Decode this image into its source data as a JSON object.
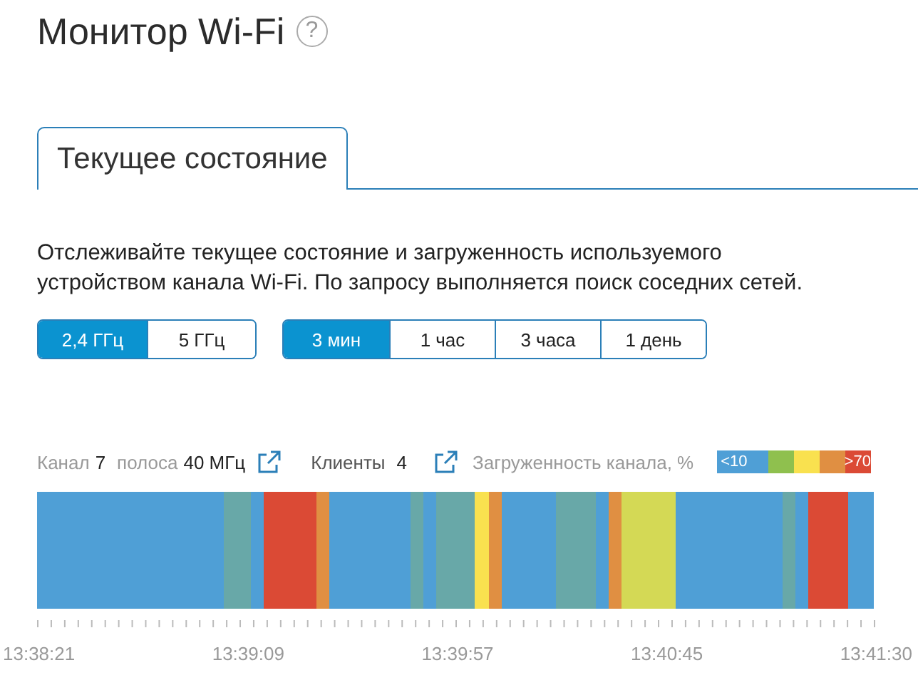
{
  "title": "Монитор Wi-Fi",
  "help": "?",
  "tabs": [
    {
      "label": "Текущее состояние",
      "selected": true
    }
  ],
  "description": "Отслеживайте текущее состояние и загруженность используемого устройством канала Wi-Fi. По запросу выполняется поиск соседних сетей.",
  "bands": [
    {
      "label": "2,4 ГГц",
      "selected": true
    },
    {
      "label": "5 ГГц",
      "selected": false
    }
  ],
  "periods": [
    {
      "label": "3 мин",
      "selected": true
    },
    {
      "label": "1 час",
      "selected": false
    },
    {
      "label": "3 часа",
      "selected": false
    },
    {
      "label": "1 день",
      "selected": false
    }
  ],
  "info": {
    "channel_label": "Канал",
    "channel": "7",
    "width_label": "полоса",
    "width": "40 МГц",
    "clients_label": "Клиенты",
    "clients": "4",
    "load_label": "Загруженность канала, %"
  },
  "legend": [
    {
      "label": "<10",
      "color": "#4f9fd6"
    },
    {
      "color": "#8fc04e"
    },
    {
      "color": "#f9e14f"
    },
    {
      "color": "#e08f42"
    },
    {
      "label": ">70",
      "color": "#db4a35"
    }
  ],
  "time_labels": [
    "13:38:21",
    "13:39:09",
    "13:39:57",
    "13:40:45",
    "13:41:30"
  ]
}
